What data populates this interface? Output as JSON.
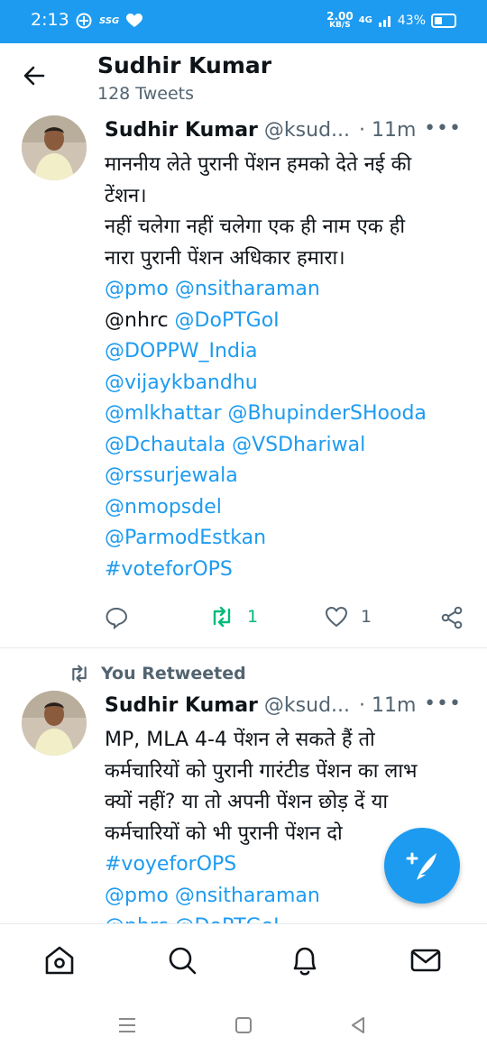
{
  "status_bar": {
    "time": "2:13",
    "carrier_icons": [
      "ssg-icon",
      "heart-icon"
    ],
    "carrier_label": "SSG",
    "speed_value": "2.00",
    "speed_unit": "KB/S",
    "network": "4G",
    "battery": "43%"
  },
  "header": {
    "title": "Sudhir Kumar",
    "subtitle": "128 Tweets"
  },
  "tweets": [
    {
      "author": "Sudhir Kumar",
      "handle": "@ksud...",
      "time": "· 11m",
      "lines": [
        "माननीय लेते पुरानी पेंशन हमको देते नई की",
        "टेंशन।",
        "नहीं चलेगा नहीं चलेगा एक ही नाम एक ही",
        "नारा पुरानी पेंशन अधिकार हमारा।"
      ],
      "mentions": [
        "@pmo @nsitharaman",
        "@nhrc",
        "@DoPTGoI",
        "@DOPPW_India",
        "@vijaykbandhu",
        "@mlkhattar @BhupinderSHooda",
        "@Dchautala @VSDhariwal",
        "@rssurjewala",
        "@nmopsdel",
        "@ParmodEstkan",
        "#voteforOPS"
      ],
      "retweets": "1",
      "likes": "1"
    },
    {
      "retweeted_label": "You Retweeted",
      "author": "Sudhir Kumar",
      "handle": "@ksud...",
      "time": "· 11m",
      "lines": [
        "MP, MLA 4-4 पेंशन ले सकते हैं तो",
        "कर्मचारियों को पुरानी गारंटीड पेंशन का लाभ",
        "क्यों नहीं? या तो अपनी पेंशन छोड़ दें या",
        "कर्मचारियों को भी पुरानी पेंशन दो"
      ],
      "mentions": [
        "#voyeforOPS",
        "@pmo @nsitharaman",
        "@nhrc @DoPTGoI"
      ]
    }
  ],
  "bottom_nav": [
    "home-icon",
    "search-icon",
    "notifications-icon",
    "messages-icon"
  ],
  "accent": "#1d9bf0",
  "retweet_color": "#00ba7c"
}
